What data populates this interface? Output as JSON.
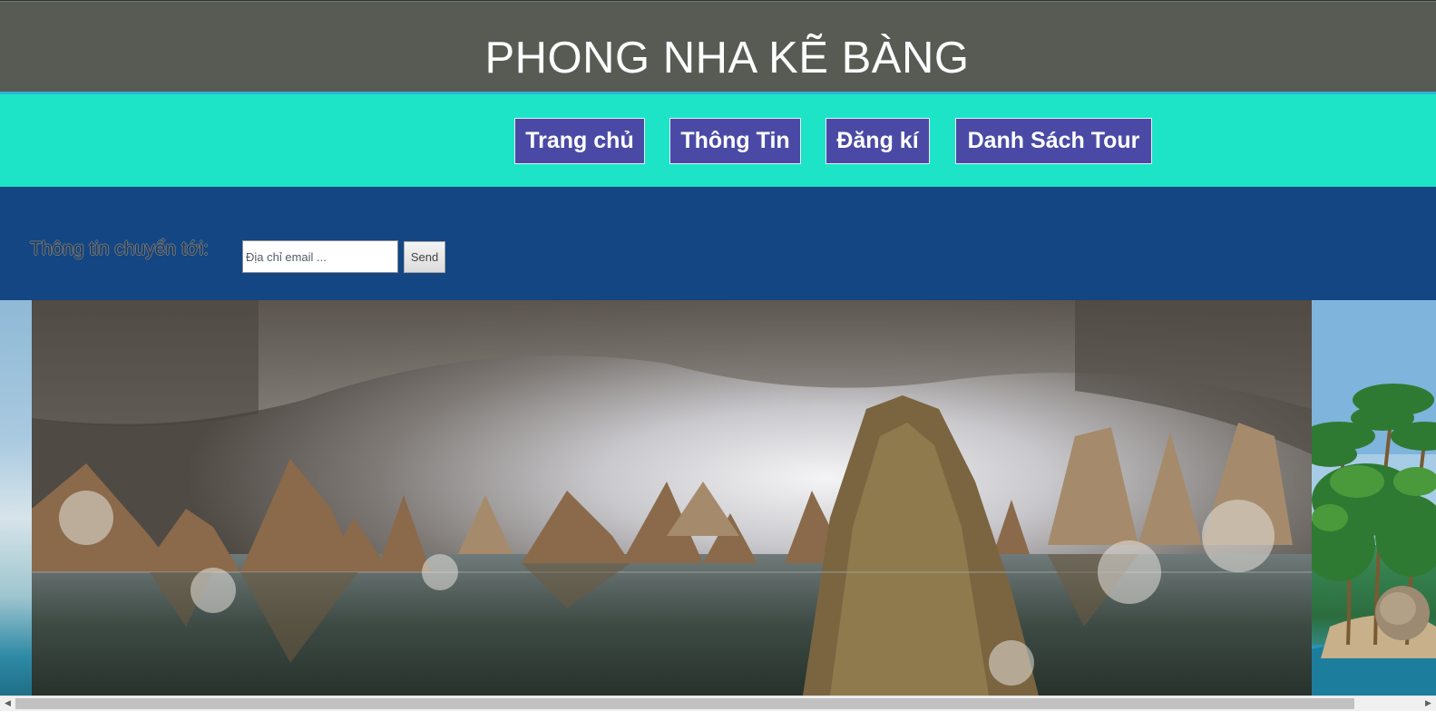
{
  "header": {
    "title": "PHONG NHA KẼ BÀNG"
  },
  "nav": {
    "items": [
      {
        "label": "Trang chủ"
      },
      {
        "label": "Thông Tin"
      },
      {
        "label": "Đăng kí"
      },
      {
        "label": "Danh Sách Tour"
      }
    ]
  },
  "subscribe": {
    "label": "Thông tin chuyển tới:",
    "email_placeholder": "Địa chỉ email ...",
    "email_value": "",
    "send_label": "Send"
  },
  "banner": {
    "image": "cave-landscape-image",
    "background_image": "tropical-beach-image"
  },
  "scrollbar": {
    "left_arrow_icon": "chevron-left-icon",
    "right_arrow_icon": "chevron-right-icon"
  },
  "colors": {
    "header_bg": "#585b54",
    "navbar_bg": "#1de3c7",
    "nav_button_bg": "#4a4aa6",
    "subscribe_band_bg": "#134682"
  }
}
